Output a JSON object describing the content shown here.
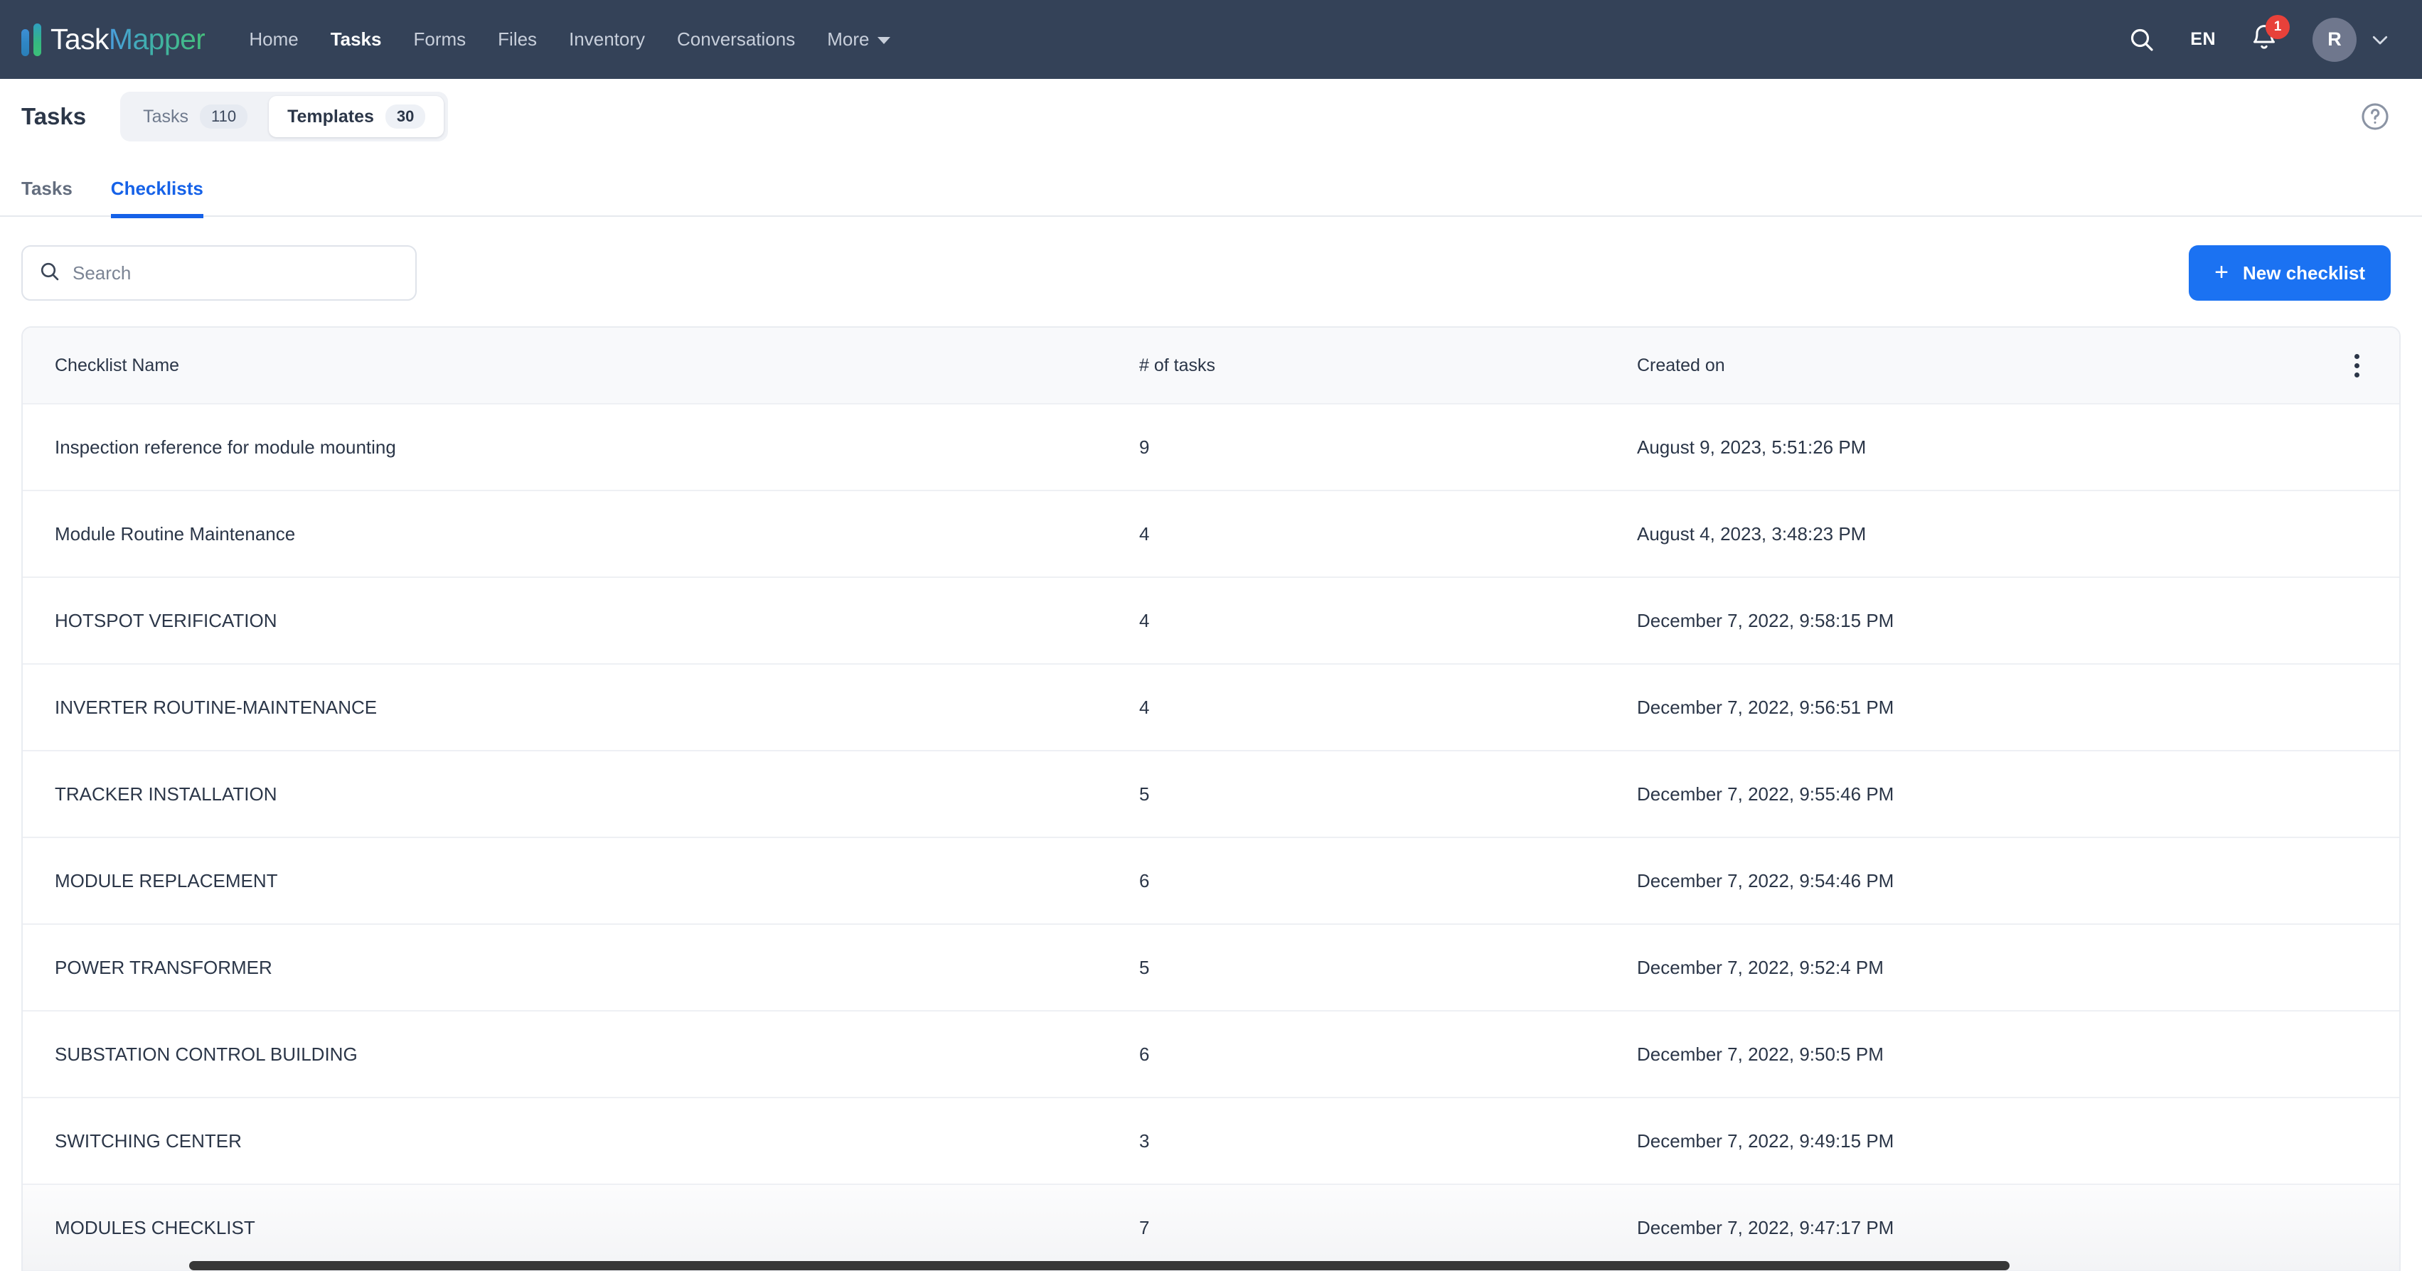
{
  "brand": {
    "name_part1": "Task",
    "name_part2": "Mapper",
    "accent_blue": "#1b72f2",
    "nav_bg": "#344258",
    "badge_red": "#e8413a"
  },
  "topnav": {
    "items": [
      {
        "label": "Home",
        "active": false
      },
      {
        "label": "Tasks",
        "active": true
      },
      {
        "label": "Forms",
        "active": false
      },
      {
        "label": "Files",
        "active": false
      },
      {
        "label": "Inventory",
        "active": false
      },
      {
        "label": "Conversations",
        "active": false
      },
      {
        "label": "More",
        "active": false,
        "has_chevron": true
      }
    ],
    "search_icon": "search-icon",
    "language": "EN",
    "notifications_icon": "bell-icon",
    "notifications_count": "1",
    "avatar_initial": "R",
    "avatar_chevron_icon": "chevron-down-icon"
  },
  "page_header": {
    "title": "Tasks",
    "segments": [
      {
        "label": "Tasks",
        "count": "110",
        "active": false
      },
      {
        "label": "Templates",
        "count": "30",
        "active": true
      }
    ],
    "help_icon": "help-circle-icon"
  },
  "subtabs": [
    {
      "label": "Tasks",
      "active": false
    },
    {
      "label": "Checklists",
      "active": true
    }
  ],
  "toolbar": {
    "search_placeholder": "Search",
    "search_value": "",
    "search_icon": "search-icon",
    "new_button_label": "New checklist",
    "new_button_icon": "plus-icon"
  },
  "table": {
    "columns": [
      {
        "key": "name",
        "label": "Checklist Name"
      },
      {
        "key": "tasks",
        "label": "# of tasks"
      },
      {
        "key": "created",
        "label": "Created on"
      }
    ],
    "menu_icon": "kebab-menu-icon",
    "rows": [
      {
        "name": "Inspection reference for module mounting",
        "tasks": "9",
        "created": "August 9, 2023, 5:51:26 PM",
        "hovered": false
      },
      {
        "name": "Module Routine Maintenance",
        "tasks": "4",
        "created": "August 4, 2023, 3:48:23 PM",
        "hovered": false
      },
      {
        "name": "HOTSPOT VERIFICATION",
        "tasks": "4",
        "created": "December 7, 2022, 9:58:15 PM",
        "hovered": false
      },
      {
        "name": "INVERTER ROUTINE-MAINTENANCE",
        "tasks": "4",
        "created": "December 7, 2022, 9:56:51 PM",
        "hovered": false
      },
      {
        "name": "TRACKER INSTALLATION",
        "tasks": "5",
        "created": "December 7, 2022, 9:55:46 PM",
        "hovered": false
      },
      {
        "name": "MODULE REPLACEMENT",
        "tasks": "6",
        "created": "December 7, 2022, 9:54:46 PM",
        "hovered": false
      },
      {
        "name": "POWER TRANSFORMER",
        "tasks": "5",
        "created": "December 7, 2022, 9:52:4 PM",
        "hovered": false
      },
      {
        "name": "SUBSTATION CONTROL BUILDING",
        "tasks": "6",
        "created": "December 7, 2022, 9:50:5 PM",
        "hovered": false
      },
      {
        "name": "SWITCHING CENTER",
        "tasks": "3",
        "created": "December 7, 2022, 9:49:15 PM",
        "hovered": false
      },
      {
        "name": "MODULES CHECKLIST",
        "tasks": "7",
        "created": "December 7, 2022, 9:47:17 PM",
        "hovered": true
      }
    ]
  }
}
